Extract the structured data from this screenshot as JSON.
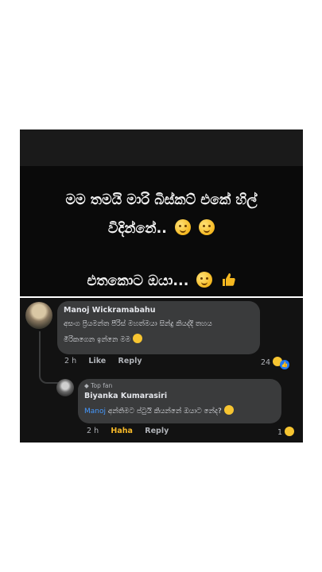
{
  "post": {
    "line1": "මම තමයි මාරි බිස්කට් එකේ හිල්",
    "line2": "විදින්නේ..",
    "line3": "එතකොට ඔයා..."
  },
  "comment": {
    "author": "Manoj Wickramabahu",
    "text_line1": "අසංග ප්‍රියමන්ත පීරිස් මහත්මයා සින්දු කියද්දි තහය",
    "text_line2": "මිරිකගෙන ඉන්නෙ මම",
    "time": "2 h",
    "like_label": "Like",
    "reply_label": "Reply",
    "reaction_count": "24"
  },
  "reply": {
    "badge": "Top fan",
    "author": "Biyanka Kumarasiri",
    "mention": "Manoj",
    "text": "අන්තිමට ප්ටුයි කියන්නේ ඔයාට නේද?",
    "time": "2 h",
    "haha_label": "Haha",
    "reply_label": "Reply",
    "reaction_count": "1"
  },
  "icons": {
    "emoji": "relieved-face-icon",
    "thumbs": "thumbs-up-icon",
    "haha": "haha-reaction-icon",
    "like": "like-reaction-icon"
  },
  "colors": {
    "bubble": "#3a3b3c",
    "mention": "#4599ff",
    "haha": "#f7b928"
  }
}
